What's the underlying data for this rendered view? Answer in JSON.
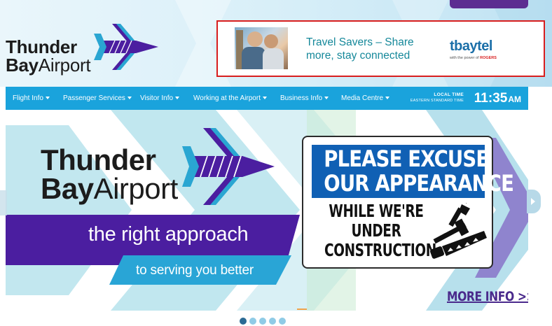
{
  "header": {
    "logo": {
      "line1": "Thunder",
      "line2_bold": "Bay",
      "line2_rest": "Airport"
    },
    "ad": {
      "text": "Travel Savers – Share more, stay connected",
      "brand": "tbaytel",
      "brand_sub_prefix": "with the power of",
      "brand_sub_partner": "ROGERS"
    }
  },
  "nav": {
    "items": [
      {
        "label": "Flight Info"
      },
      {
        "label": "Passenger Services"
      },
      {
        "label": "Visitor Info"
      },
      {
        "label": "Working at the Airport"
      },
      {
        "label": "Business Info"
      },
      {
        "label": "Media Centre"
      }
    ],
    "clock": {
      "label": "LOCAL TIME",
      "zone": "EASTERN STANDARD TIME",
      "time": "11:35",
      "ampm": "AM"
    }
  },
  "hero": {
    "logo": {
      "line1": "Thunder",
      "line2_bold": "Bay",
      "line2_rest": "Airport"
    },
    "tagline": "the right approach",
    "subtagline": "to serving you better",
    "sign": {
      "top_line1": "PLEASE EXCUSE",
      "top_line2": "OUR APPEARANCE",
      "line1": "WHILE WE'RE",
      "line2": "UNDER",
      "line3": "CONSTRUCTION"
    },
    "more_info": "MORE INFO >>"
  },
  "carousel": {
    "slide_count": 5,
    "active_index": 0
  },
  "colors": {
    "nav": "#1aa3dc",
    "purple": "#4b1ea0",
    "teal": "#2aa6d2",
    "sign_blue": "#1060b4",
    "ad_border": "#d81e1e"
  }
}
